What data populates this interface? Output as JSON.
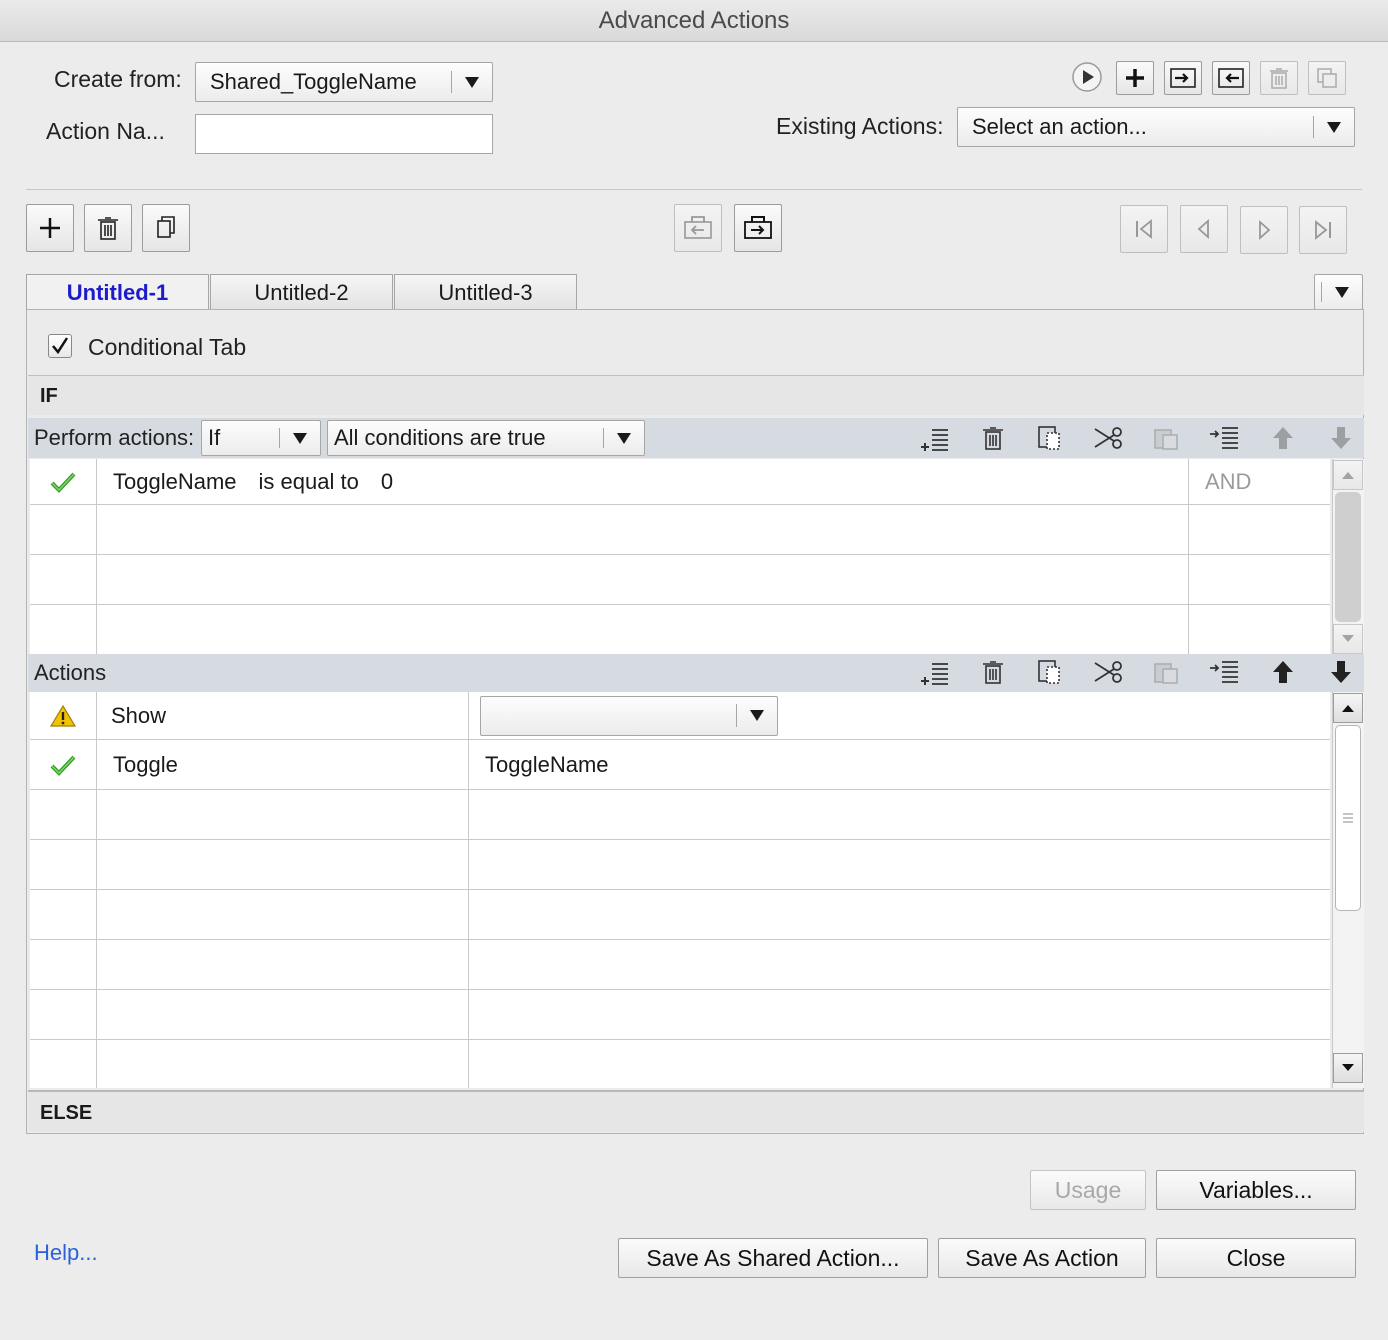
{
  "window": {
    "title": "Advanced Actions"
  },
  "top": {
    "create_from_label": "Create from:",
    "create_from_value": "Shared_ToggleName",
    "action_name_label": "Action Na...",
    "action_name_value": "",
    "existing_actions_label": "Existing Actions:",
    "existing_actions_value": "Select an action..."
  },
  "tabs": [
    {
      "label": "Untitled-1",
      "active": true
    },
    {
      "label": "Untitled-2",
      "active": false
    },
    {
      "label": "Untitled-3",
      "active": false
    }
  ],
  "conditional": {
    "label": "Conditional Tab",
    "checked": true
  },
  "if_section": {
    "header": "IF",
    "perform_label": "Perform actions:",
    "perform_value": "If",
    "conditions_value": "All conditions are true",
    "rows": [
      {
        "status": "ok",
        "variable": "ToggleName",
        "operator": "is equal to",
        "value": "0",
        "logic": "AND"
      }
    ]
  },
  "actions_section": {
    "header": "Actions",
    "rows": [
      {
        "status": "warning",
        "action": "Show",
        "target": ""
      },
      {
        "status": "ok",
        "action": "Toggle",
        "target": "ToggleName"
      }
    ]
  },
  "else_section": {
    "header": "ELSE"
  },
  "buttons": {
    "usage": "Usage",
    "variables": "Variables...",
    "save_shared": "Save As Shared Action...",
    "save_action": "Save As Action",
    "close": "Close",
    "help": "Help..."
  },
  "colors": {
    "active_tab": "#1c1ccc",
    "help_link": "#2b62d6",
    "check_green": "#2e9e1f",
    "warning": "#f2c200"
  }
}
